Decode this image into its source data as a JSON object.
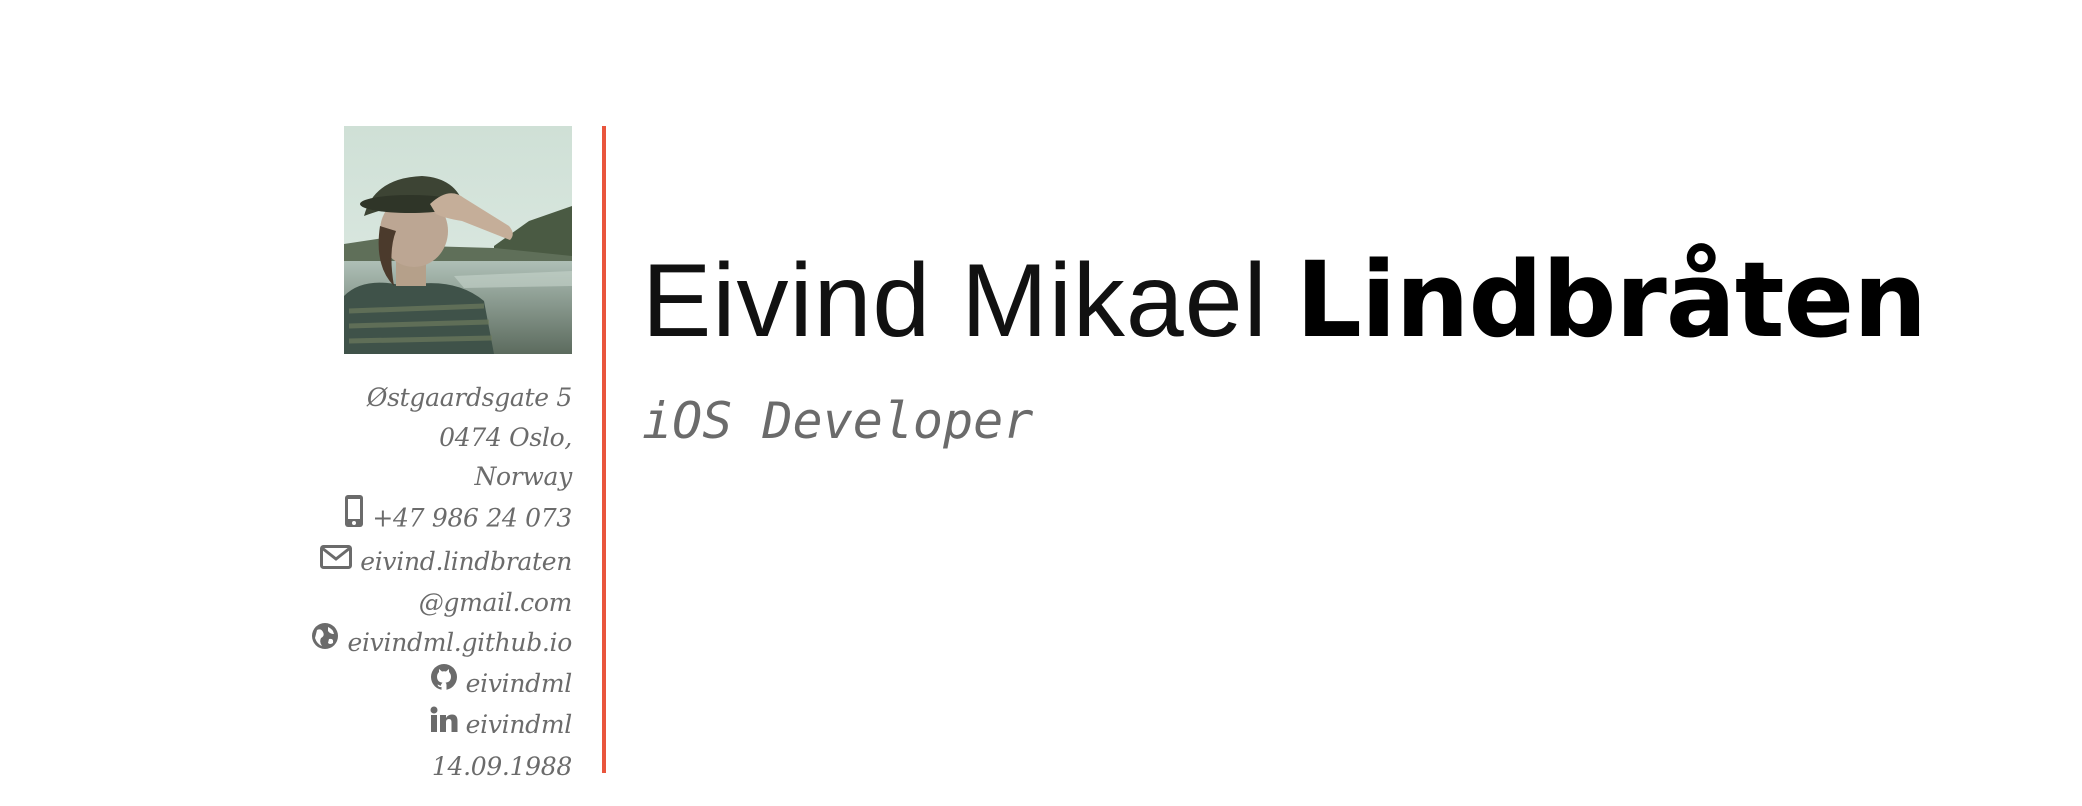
{
  "profile": {
    "first_names": "Eivind Mikael",
    "last_name": "Lindbråten",
    "role": "iOS Developer"
  },
  "contact": {
    "address_line1": "Østgaardsgate 5",
    "address_line2": "0474 Oslo,",
    "address_line3": "Norway",
    "phone": "+47 986 24 073",
    "email_line1": "eivind.lindbraten",
    "email_line2": "@gmail.com",
    "website": "eivindml.github.io",
    "github": "eivindml",
    "linkedin": "eivindml",
    "birthdate": "14.09.1988"
  },
  "colors": {
    "accent": "#e9553d",
    "muted_text": "#6b6b6b",
    "heading_text": "#000000"
  },
  "icons": {
    "phone": "phone-icon",
    "email": "envelope-icon",
    "website": "globe-icon",
    "github": "github-icon",
    "linkedin": "linkedin-icon"
  }
}
